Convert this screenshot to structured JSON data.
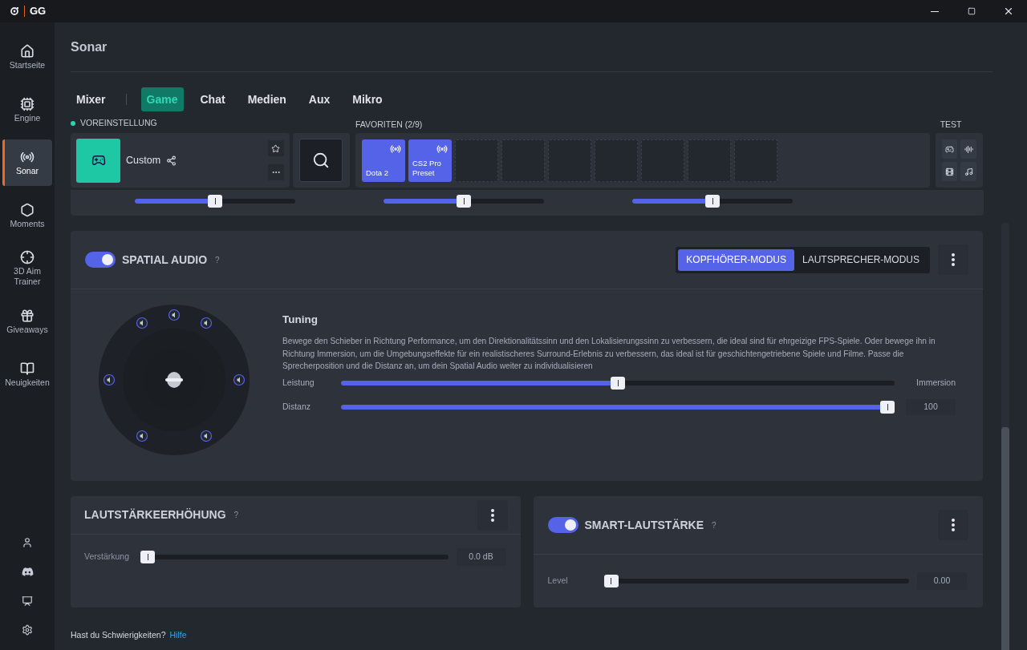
{
  "window": {
    "title": "GG"
  },
  "sidebar": {
    "items": [
      {
        "label": "Startseite",
        "selected": false
      },
      {
        "label": "Engine",
        "selected": false
      },
      {
        "label": "Sonar",
        "selected": true
      },
      {
        "label": "Moments",
        "selected": false
      },
      {
        "label": "3D Aim Trainer",
        "selected": false
      },
      {
        "label": "Giveaways",
        "selected": false
      },
      {
        "label": "Neuigkeiten",
        "selected": false
      }
    ]
  },
  "page_title": "Sonar",
  "tabs": [
    {
      "label": "Mixer",
      "selected": false
    },
    {
      "label": "Game",
      "selected": true
    },
    {
      "label": "Chat",
      "selected": false
    },
    {
      "label": "Medien",
      "selected": false
    },
    {
      "label": "Aux",
      "selected": false
    },
    {
      "label": "Mikro",
      "selected": false
    }
  ],
  "preset": {
    "heading": "VOREINSTELLUNG",
    "name": "Custom"
  },
  "favorites": {
    "heading": "FAVORITEN (2/9)",
    "slots": [
      {
        "filled": true,
        "label": "Dota 2"
      },
      {
        "filled": true,
        "label": "CS2 Pro Preset"
      },
      {
        "filled": false
      },
      {
        "filled": false
      },
      {
        "filled": false
      },
      {
        "filled": false
      },
      {
        "filled": false
      },
      {
        "filled": false
      },
      {
        "filled": false
      }
    ]
  },
  "test": {
    "heading": "TEST"
  },
  "equalizer": {
    "bands": [
      {
        "level": 0.5
      },
      {
        "level": 0.5
      },
      {
        "level": 0.5
      }
    ]
  },
  "spatial_audio": {
    "title": "SPATIAL AUDIO",
    "help": "?",
    "on": true,
    "modes": [
      {
        "label": "KOPFHÖRER-MODUS",
        "selected": true
      },
      {
        "label": "LAUTSPRECHER-MODUS",
        "selected": false
      }
    ],
    "tuning": {
      "title": "Tuning",
      "description": "Bewege den Schieber in Richtung Performance, um den Direktionalitätssinn und den Lokalisierungssinn zu verbessern, die ideal sind für ehrgeizige FPS-Spiele. Oder bewege ihn in Richtung Immersion, um die Umgebungseffekte für ein realistischeres Surround-Erlebnis zu verbessern, das ideal ist für geschichtengetriebene Spiele und Filme. Passe die Sprecherposition und die Distanz an, um dein Spatial Audio weiter zu individualisieren",
      "sliders": [
        {
          "label": "Leistung",
          "level": 0.5,
          "end_label": "Immersion"
        },
        {
          "label": "Distanz",
          "level": 1,
          "reading": "100"
        }
      ]
    }
  },
  "volume_boost": {
    "title": "LAUTSTÄRKEERHÖHUNG",
    "help": "?",
    "slider": {
      "label": "Verstärkung",
      "level": 0,
      "reading": "0.0 dB"
    }
  },
  "smart_volume": {
    "title": "SMART-LAUTSTÄRKE",
    "help": "?",
    "on": true,
    "slider": {
      "label": "Level",
      "level": 0,
      "reading": "0.00"
    }
  },
  "footer": {
    "text": "Hast du Schwierigkeiten?",
    "link": "Hilfe"
  }
}
